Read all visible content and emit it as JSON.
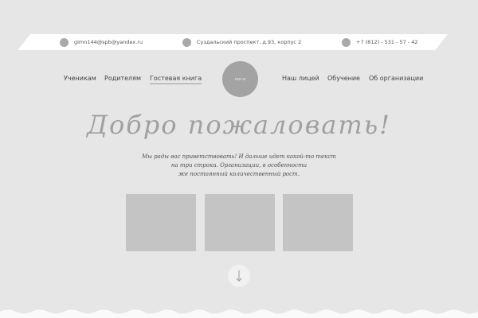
{
  "topbar": {
    "email": {
      "icon": "email-icon",
      "text": "gimn144@spb@yandex.ru"
    },
    "address": {
      "icon": "location-icon",
      "text": "Суздальский проспект, д.93, корпус 2"
    },
    "phone": {
      "icon": "phone-icon",
      "text": "+7 (812) - 531 - 57 - 42"
    }
  },
  "nav": {
    "left": [
      {
        "label": "Ученикам"
      },
      {
        "label": "Родителям"
      },
      {
        "label": "Гостевая книга",
        "active": true
      }
    ],
    "logo_label": "лого",
    "right": [
      {
        "label": "Наш лицей"
      },
      {
        "label": "Обучение"
      },
      {
        "label": "Об организации"
      }
    ]
  },
  "hero": {
    "title": "Добро пожаловать!",
    "lines": [
      "Мы рады вас приветствовать! И дальше идет какой-то текст",
      "на три строки. Организации, в особенности",
      "же постоянный количественный рост."
    ]
  },
  "colors": {
    "background": "#e6e6e6",
    "topbar": "#ffffff",
    "placeholder": "#c4c4c4",
    "logo": "#a3a3a3"
  },
  "scroll_icon": "arrow-down-icon"
}
